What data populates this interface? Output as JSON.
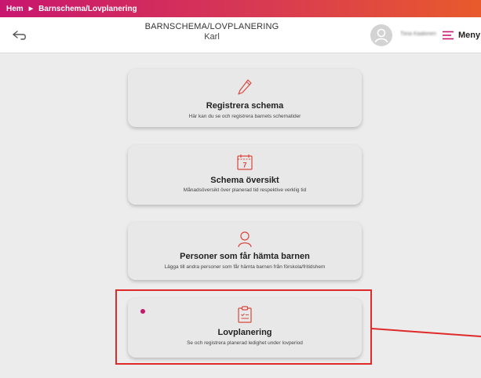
{
  "breadcrumb": {
    "home": "Hem",
    "current": "Barnschema/Lovplanering"
  },
  "header": {
    "title": "BARNSCHEMA/LOVPLANERING",
    "subtitle": "Karl",
    "user_name": "Tiina Kaakinen",
    "menu_label": "Meny"
  },
  "cards": [
    {
      "title": "Registrera schema",
      "description": "Här kan du se och registrera barnets schematider",
      "icon": "pencil-icon"
    },
    {
      "title": "Schema översikt",
      "description": "Månadsöversikt över planerad tid respektive verklig tid",
      "icon": "calendar-icon",
      "icon_text": "7"
    },
    {
      "title": "Personer som får hämta barnen",
      "description": "Lägga till andra personer som får hämta barnen från förskola/fritidshem",
      "icon": "person-icon"
    },
    {
      "title": "Lovplanering",
      "description": "Se och registrera planerad ledighet under lovperiod",
      "icon": "clipboard-icon"
    }
  ],
  "colors": {
    "accent": "#c8166f",
    "highlight": "#e02a2a",
    "icon_stroke": "#d8483c"
  }
}
